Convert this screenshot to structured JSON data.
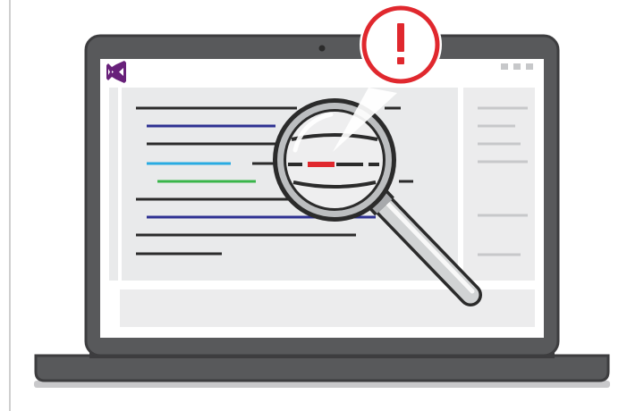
{
  "illustration": {
    "app_logo_icon": "visual-studio-logo-icon",
    "alert_icon": "exclamation-alert-icon",
    "inspect_icon": "magnifying-glass-icon",
    "window_controls_icon": "window-dots-icon"
  },
  "colors": {
    "laptop_body": "#58595b",
    "laptop_outline": "#3d3d3f",
    "screen_bg": "#ffffff",
    "editor_bg": "#e9eaeb",
    "panel_bg": "#ececed",
    "code_black": "#2b2b2b",
    "code_navy": "#2e3192",
    "code_cyan": "#29abe2",
    "code_green": "#39b54a",
    "code_gray": "#c7c8ca",
    "error_red": "#e0282e",
    "logo_purple": "#68217a"
  }
}
